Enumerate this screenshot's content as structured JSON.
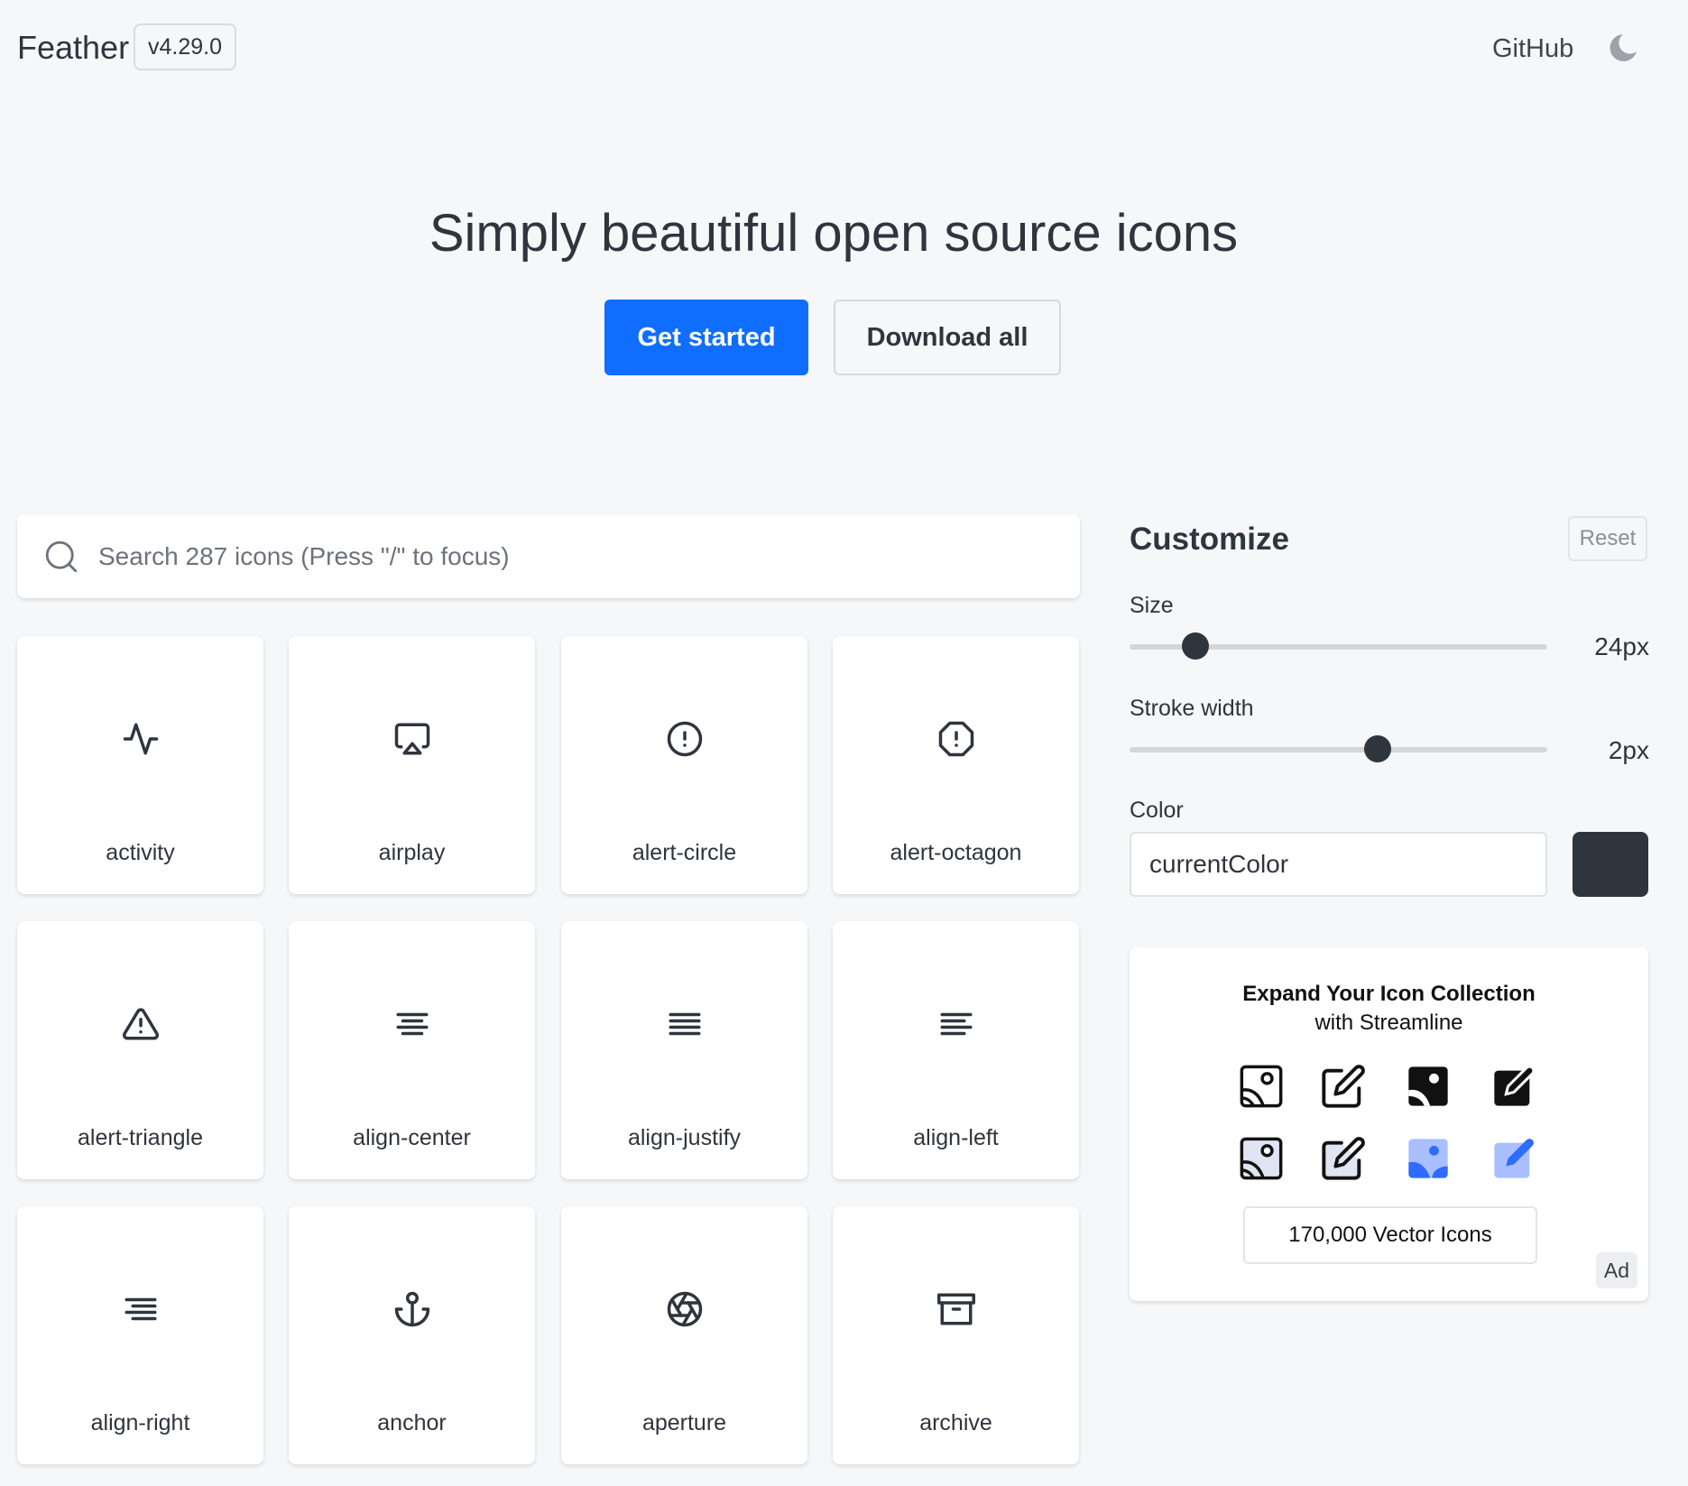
{
  "header": {
    "brand": "Feather",
    "version": "v4.29.0",
    "github_label": "GitHub",
    "theme_icon": "moon-icon"
  },
  "hero": {
    "title": "Simply beautiful open source icons",
    "primary_button": "Get started",
    "secondary_button": "Download all"
  },
  "search": {
    "placeholder": "Search 287 icons (Press \"/\" to focus)",
    "value": "",
    "icon": "search-icon"
  },
  "icons": [
    {
      "label": "activity",
      "icon": "activity-icon"
    },
    {
      "label": "airplay",
      "icon": "airplay-icon"
    },
    {
      "label": "alert-circle",
      "icon": "alert-circle-icon"
    },
    {
      "label": "alert-octagon",
      "icon": "alert-octagon-icon"
    },
    {
      "label": "alert-triangle",
      "icon": "alert-triangle-icon"
    },
    {
      "label": "align-center",
      "icon": "align-center-icon"
    },
    {
      "label": "align-justify",
      "icon": "align-justify-icon"
    },
    {
      "label": "align-left",
      "icon": "align-left-icon"
    },
    {
      "label": "align-right",
      "icon": "align-right-icon"
    },
    {
      "label": "anchor",
      "icon": "anchor-icon"
    },
    {
      "label": "aperture",
      "icon": "aperture-icon"
    },
    {
      "label": "archive",
      "icon": "archive-icon"
    }
  ],
  "customize": {
    "title": "Customize",
    "reset_label": "Reset",
    "size_label": "Size",
    "size_value": "24px",
    "size_fraction": 0.133,
    "stroke_label": "Stroke width",
    "stroke_value": "2px",
    "stroke_fraction": 0.6,
    "color_label": "Color",
    "color_value": "currentColor",
    "swatch_color": "#2f353d"
  },
  "ad": {
    "title": "Expand Your Icon Collection",
    "subtitle": "with Streamline",
    "icons": [
      "image-outline-icon",
      "edit-outline-icon",
      "image-solid-icon",
      "edit-solid-icon",
      "image-duotone-icon",
      "edit-duotone-icon",
      "image-blue-icon",
      "edit-blue-icon"
    ],
    "cta": "170,000 Vector Icons",
    "badge": "Ad",
    "accent": "#2f6bff",
    "accent_light": "#a9bfff"
  },
  "colors": {
    "primary": "#0f6efd",
    "text": "#2f353d",
    "background": "#f6f7f9"
  }
}
